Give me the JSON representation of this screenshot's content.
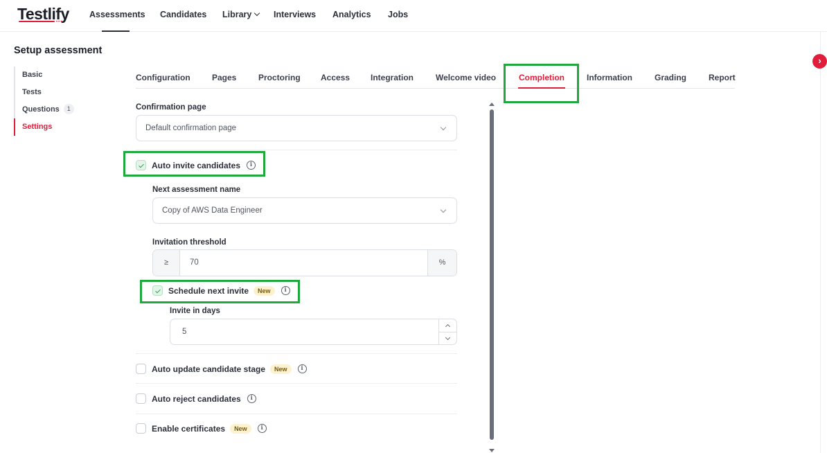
{
  "brand": {
    "logo_text": "Testlify",
    "accent": "#e01e3c",
    "highlight": "#1fa83b"
  },
  "nav": {
    "items": [
      "Assessments",
      "Candidates",
      "Library",
      "Interviews",
      "Analytics",
      "Jobs"
    ],
    "active": "Assessments"
  },
  "page": {
    "title": "Setup assessment"
  },
  "steps": {
    "items": [
      {
        "label": "Basic"
      },
      {
        "label": "Tests"
      },
      {
        "label": "Questions",
        "count": "1"
      },
      {
        "label": "Settings"
      }
    ],
    "active": "Settings"
  },
  "tabs": {
    "items": [
      "Configuration",
      "Pages",
      "Proctoring",
      "Access",
      "Integration",
      "Welcome video",
      "Completion",
      "Information",
      "Grading",
      "Report"
    ],
    "active": "Completion"
  },
  "form": {
    "confirmation_page": {
      "label": "Confirmation page",
      "value": "Default confirmation page"
    },
    "auto_invite": {
      "label": "Auto invite candidates",
      "checked": true
    },
    "next_assessment": {
      "label": "Next assessment name",
      "value": "Copy of AWS Data Engineer"
    },
    "threshold": {
      "label": "Invitation threshold",
      "prefix": "≥",
      "value": "70",
      "suffix": "%"
    },
    "schedule_next_invite": {
      "label": "Schedule next invite",
      "badge": "New",
      "checked": true
    },
    "invite_days": {
      "label": "Invite in days",
      "value": "5"
    },
    "auto_update_stage": {
      "label": "Auto update candidate stage",
      "badge": "New",
      "checked": false
    },
    "auto_reject": {
      "label": "Auto reject candidates",
      "checked": false
    },
    "certificates": {
      "label": "Enable certificates",
      "badge": "New",
      "checked": false
    }
  },
  "icons": {
    "info": "info-icon",
    "collapse": "chevron-right-icon",
    "dropdown": "chevron-down-icon",
    "check": "check-icon"
  }
}
